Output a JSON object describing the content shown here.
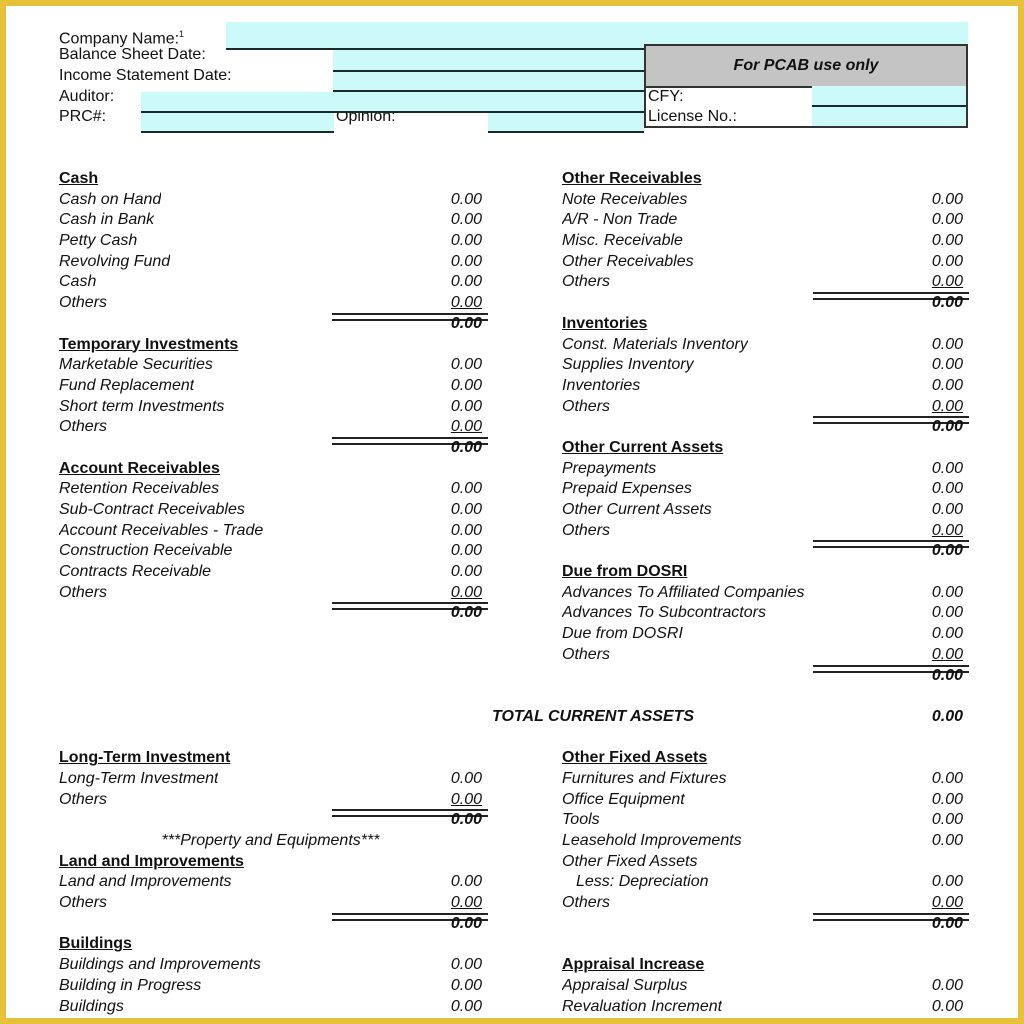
{
  "header": {
    "company_name_label": "Company Name:",
    "company_name_footnote": "1",
    "balance_sheet_date_label": "Balance Sheet Date:",
    "income_statement_date_label": "Income Statement Date:",
    "auditor_label": "Auditor:",
    "prc_label": "PRC#:",
    "opinion_label": "Opinion:",
    "company_name_value": "",
    "balance_sheet_date_value": "",
    "income_statement_date_value": "",
    "auditor_value": "",
    "prc_value": "",
    "opinion_value": ""
  },
  "pcab": {
    "title": "For PCAB use only",
    "cfy_label": "CFY:",
    "license_label": "License No.:",
    "cfy_value": "",
    "license_value": ""
  },
  "field_color": "#ccfaf8",
  "left": {
    "cash": {
      "title": "Cash",
      "items": [
        {
          "name": "Cash on Hand",
          "value": "0.00"
        },
        {
          "name": "Cash in Bank",
          "value": "0.00"
        },
        {
          "name": "Petty Cash",
          "value": "0.00"
        },
        {
          "name": "Revolving Fund",
          "value": "0.00"
        },
        {
          "name": "Cash",
          "value": "0.00"
        },
        {
          "name": "Others",
          "value": "0.00"
        }
      ],
      "total": "0.00"
    },
    "temporary_investments": {
      "title": "Temporary Investments",
      "items": [
        {
          "name": "Marketable Securities",
          "value": "0.00"
        },
        {
          "name": "Fund Replacement",
          "value": "0.00"
        },
        {
          "name": "Short term Investments",
          "value": "0.00"
        },
        {
          "name": "Others",
          "value": "0.00"
        }
      ],
      "total": "0.00"
    },
    "account_receivables": {
      "title": "Account Receivables",
      "items": [
        {
          "name": "Retention Receivables",
          "value": "0.00"
        },
        {
          "name": "Sub-Contract Receivables",
          "value": "0.00"
        },
        {
          "name": "Account Receivables - Trade",
          "value": "0.00"
        },
        {
          "name": "Construction Receivable",
          "value": "0.00"
        },
        {
          "name": "Contracts Receivable",
          "value": "0.00"
        },
        {
          "name": "Others",
          "value": "0.00"
        }
      ],
      "total": "0.00"
    },
    "long_term_investment": {
      "title": "Long-Term Investment",
      "items": [
        {
          "name": "Long-Term Investment",
          "value": "0.00"
        },
        {
          "name": "Others",
          "value": "0.00"
        }
      ],
      "total": "0.00"
    },
    "property_note": "***Property and Equipments***",
    "land_improvements": {
      "title": "Land and Improvements",
      "items": [
        {
          "name": "Land and Improvements",
          "value": "0.00"
        },
        {
          "name": "Others",
          "value": "0.00"
        }
      ],
      "total": "0.00"
    },
    "buildings": {
      "title": "Buildings",
      "items": [
        {
          "name": "Buildings and Improvements",
          "value": "0.00"
        },
        {
          "name": "Building in Progress",
          "value": "0.00"
        },
        {
          "name": "Buildings",
          "value": "0.00"
        }
      ]
    }
  },
  "right": {
    "other_receivables": {
      "title": "Other Receivables",
      "items": [
        {
          "name": "Note Receivables",
          "value": "0.00"
        },
        {
          "name": "A/R - Non Trade",
          "value": "0.00"
        },
        {
          "name": "Misc. Receivable",
          "value": "0.00"
        },
        {
          "name": "Other Receivables",
          "value": "0.00"
        },
        {
          "name": "Others",
          "value": "0.00"
        }
      ],
      "total": "0.00"
    },
    "inventories": {
      "title": "Inventories",
      "items": [
        {
          "name": "Const. Materials Inventory",
          "value": "0.00"
        },
        {
          "name": "Supplies Inventory",
          "value": "0.00"
        },
        {
          "name": "Inventories",
          "value": "0.00"
        },
        {
          "name": "Others",
          "value": "0.00"
        }
      ],
      "total": "0.00"
    },
    "other_current_assets": {
      "title": "Other Current Assets",
      "items": [
        {
          "name": "Prepayments",
          "value": "0.00"
        },
        {
          "name": "Prepaid Expenses",
          "value": "0.00"
        },
        {
          "name": "Other Current Assets",
          "value": "0.00"
        },
        {
          "name": "Others",
          "value": "0.00"
        }
      ],
      "total": "0.00"
    },
    "due_from_dosri": {
      "title": "Due from DOSRI",
      "items": [
        {
          "name": "Advances To Affiliated Companies",
          "value": "0.00"
        },
        {
          "name": "Advances To Subcontractors",
          "value": "0.00"
        },
        {
          "name": "Due from DOSRI",
          "value": "0.00"
        },
        {
          "name": "Others",
          "value": "0.00"
        }
      ],
      "total": "0.00"
    },
    "total_current_assets_label": "TOTAL CURRENT ASSETS",
    "total_current_assets_value": "0.00",
    "other_fixed_assets": {
      "title": "Other Fixed Assets",
      "items": [
        {
          "name": "Furnitures and Fixtures",
          "value": "0.00"
        },
        {
          "name": "Office Equipment",
          "value": "0.00"
        },
        {
          "name": "Tools",
          "value": "0.00"
        },
        {
          "name": "Leasehold Improvements",
          "value": "0.00"
        },
        {
          "name": "Other Fixed Assets",
          "value": ""
        },
        {
          "name": "Less: Depreciation",
          "value": "0.00",
          "indent": true
        },
        {
          "name": "Others",
          "value": "0.00"
        }
      ],
      "total": "0.00"
    },
    "appraisal_increase": {
      "title": "Appraisal Increase",
      "items": [
        {
          "name": "Appraisal Surplus",
          "value": "0.00"
        },
        {
          "name": "Revaluation Increment",
          "value": "0.00"
        }
      ]
    }
  }
}
